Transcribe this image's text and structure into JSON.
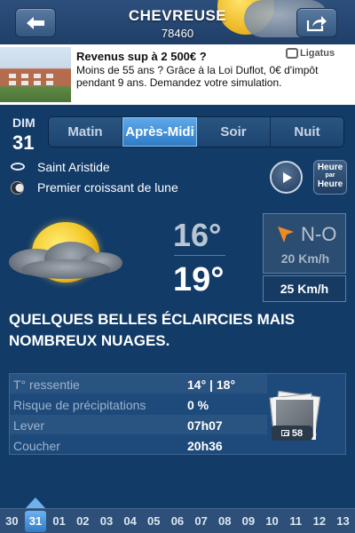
{
  "header": {
    "city": "CHEVREUSE",
    "zip": "78460"
  },
  "ad": {
    "title": "Revenus sup à 2 500€ ?",
    "text": "Moins de 55 ans ? Grâce à la Loi Duflot, 0€ d'impôt pendant 9 ans. Demandez votre simulation.",
    "brand": "Ligatus"
  },
  "date": {
    "day_label": "DIM",
    "day_number": "31"
  },
  "tabs": [
    {
      "label": "Matin",
      "active": false
    },
    {
      "label": "Après-Midi",
      "active": true
    },
    {
      "label": "Soir",
      "active": false
    },
    {
      "label": "Nuit",
      "active": false
    }
  ],
  "saint": "Saint Aristide",
  "moon_phase": "Premier croissant de lune",
  "hour_button": {
    "line1": "Heure",
    "line2": "par",
    "line3": "Heure"
  },
  "weather": {
    "icon": "sun-cloud-icon",
    "temp_high": "16°",
    "temp_low": "19°",
    "wind_direction": "N-O",
    "wind_speed": "20 Km/h",
    "gust_speed": "25 Km/h",
    "description": "QUELQUES BELLES ÉCLAIRCIES MAIS NOMBREUX NUAGES."
  },
  "details": [
    {
      "label": "T° ressentie",
      "value": "14° | 18°"
    },
    {
      "label": "Risque de précipitations",
      "value": "0 %"
    },
    {
      "label": "Lever",
      "value": "07h07"
    },
    {
      "label": "Coucher",
      "value": "20h36"
    }
  ],
  "photos": {
    "count": "58"
  },
  "days": [
    "30",
    "31",
    "01",
    "02",
    "03",
    "04",
    "05",
    "06",
    "07",
    "08",
    "09",
    "10",
    "11",
    "12",
    "13"
  ],
  "active_day": "31",
  "colors": {
    "accent": "#2f7cc7",
    "background": "#123b68",
    "wind_arrow": "#f08a24"
  }
}
